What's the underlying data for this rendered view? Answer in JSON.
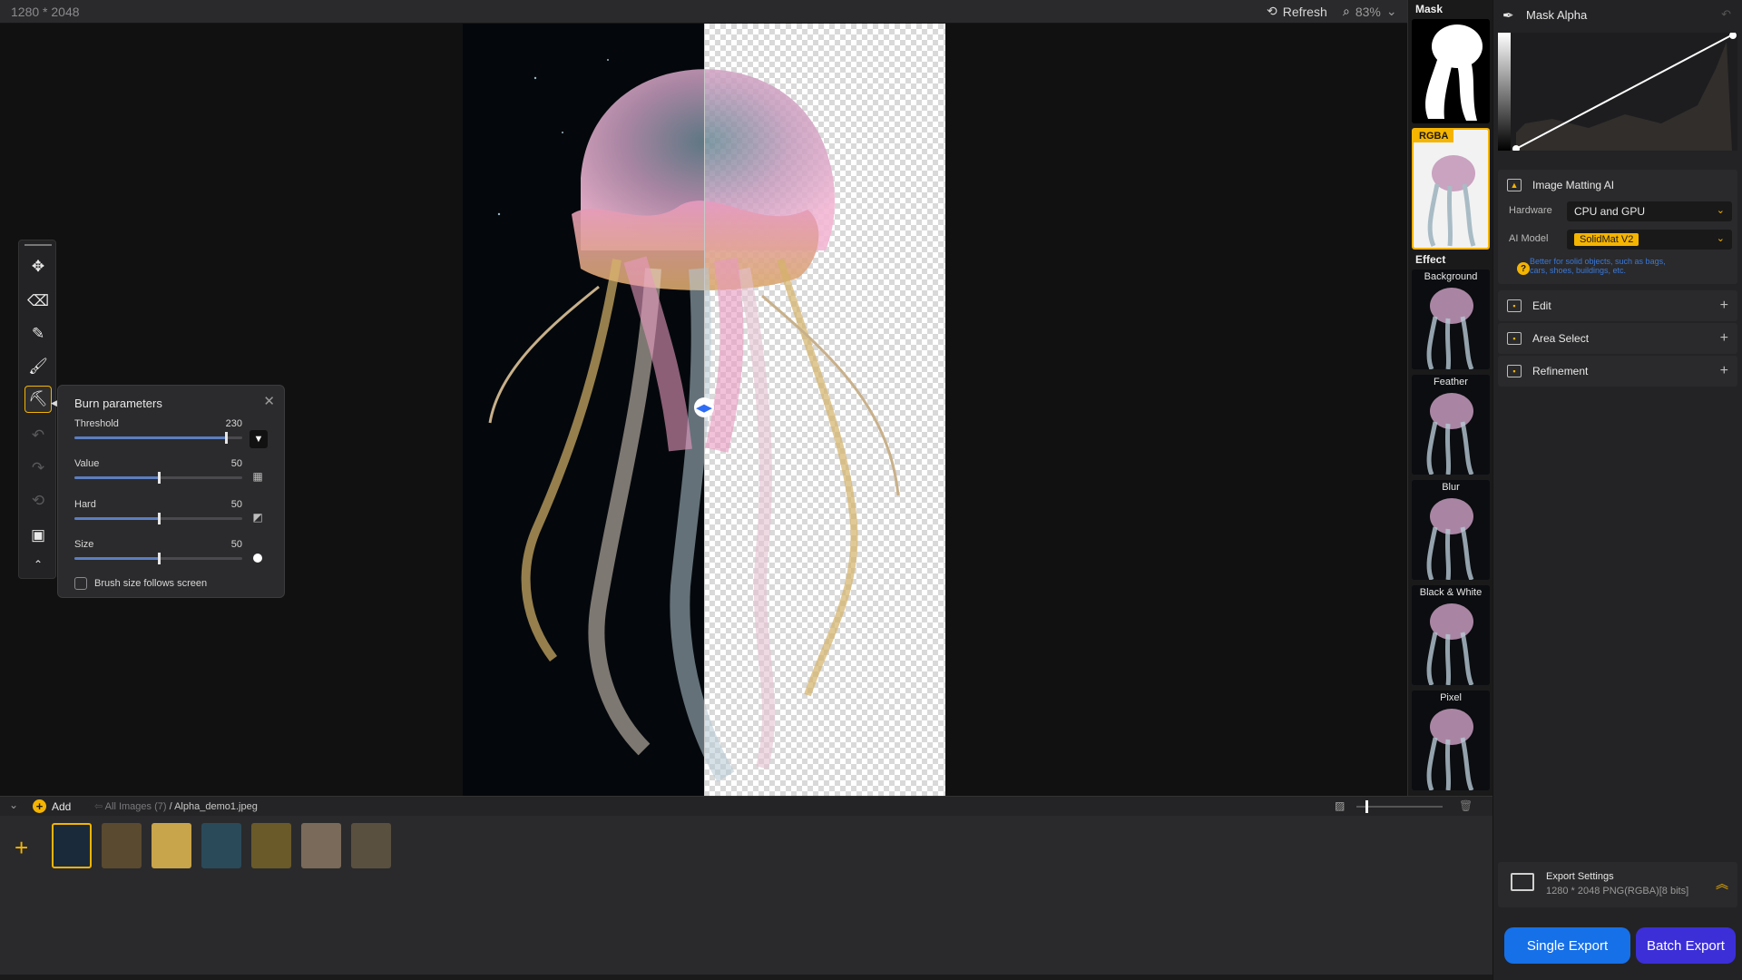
{
  "topbar": {
    "dimensions": "1280 * 2048",
    "refresh_label": "Refresh",
    "zoom": "83%"
  },
  "burn": {
    "title": "Burn parameters",
    "params": [
      {
        "label": "Threshold",
        "value": "230",
        "fraction": 0.9
      },
      {
        "label": "Value",
        "value": "50",
        "fraction": 0.5
      },
      {
        "label": "Hard",
        "value": "50",
        "fraction": 0.5
      },
      {
        "label": "Size",
        "value": "50",
        "fraction": 0.5
      }
    ],
    "checkbox_label": "Brush size follows screen"
  },
  "strip": {
    "mask_label": "Mask",
    "rgba_label": "RGBA",
    "effect_label": "Effect",
    "effects": [
      "Background",
      "Feather",
      "Blur",
      "Black & White",
      "Pixel"
    ]
  },
  "panel": {
    "mask_alpha_title": "Mask Alpha",
    "matting_title": "Image Matting AI",
    "hardware_label": "Hardware",
    "hardware_value": "CPU and GPU",
    "model_label": "AI Model",
    "model_value": "SolidMat V2",
    "hint": "Better for solid objects, such as bags, cars, shoes, buildings, etc.",
    "sections": [
      "Edit",
      "Area Select",
      "Refinement"
    ],
    "export_title": "Export Settings",
    "export_detail": "1280 * 2048 PNG(RGBA)[8 bits]",
    "single_export": "Single Export",
    "batch_export": "Batch Export"
  },
  "bottom": {
    "add_label": "Add",
    "path_root": "All Images (7)",
    "path_file": "/ Alpha_demo1.jpeg",
    "thumbnail_count": 7
  },
  "colors": {
    "accent": "#f5b400",
    "single_export": "#1670e8",
    "batch_export": "#3c2fd8",
    "slider_fill": "#5c7ec0"
  }
}
